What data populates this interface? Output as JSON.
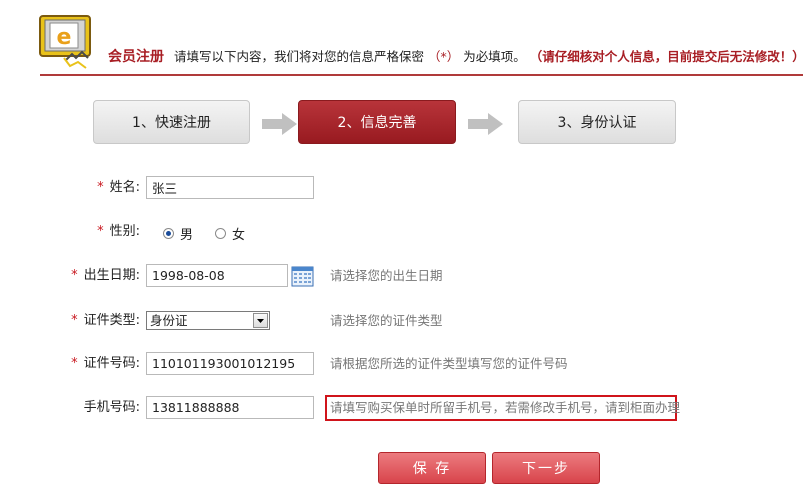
{
  "header": {
    "title": "会员注册",
    "desc_before": "请填写以下内容，我们将对您的信息严格保密",
    "req_mark": "（*）",
    "desc_after": "为必填项。",
    "warning": "（请仔细核对个人信息，目前提交后无法修改！）",
    "logo_letter": "e"
  },
  "steps": [
    {
      "label": "1、快速注册",
      "active": false
    },
    {
      "label": "2、信息完善",
      "active": true
    },
    {
      "label": "3、身份认证",
      "active": false
    }
  ],
  "form": {
    "name": {
      "label": "姓名:",
      "value": "张三",
      "required": true
    },
    "gender": {
      "label": "性别:",
      "required": true,
      "options": [
        "男",
        "女"
      ],
      "selected": "男"
    },
    "birth": {
      "label": "出生日期:",
      "value": "1998-08-08",
      "hint": "请选择您的出生日期",
      "required": true
    },
    "id_type": {
      "label": "证件类型:",
      "value": "身份证",
      "hint": "请选择您的证件类型",
      "required": true
    },
    "id_number": {
      "label": "证件号码:",
      "value": "110101193001012195",
      "hint": "请根据您所选的证件类型填写您的证件号码",
      "required": true
    },
    "phone": {
      "label": "手机号码:",
      "value": "13811888888",
      "hint": "请填写购买保单时所留手机号，若需修改手机号，请到柜面办理",
      "required": false
    }
  },
  "buttons": {
    "save": "保 存",
    "next": "下一步"
  },
  "colors": {
    "brand": "#a81e24",
    "required_star": "#c8161d",
    "highlight_border": "#d0141b"
  }
}
